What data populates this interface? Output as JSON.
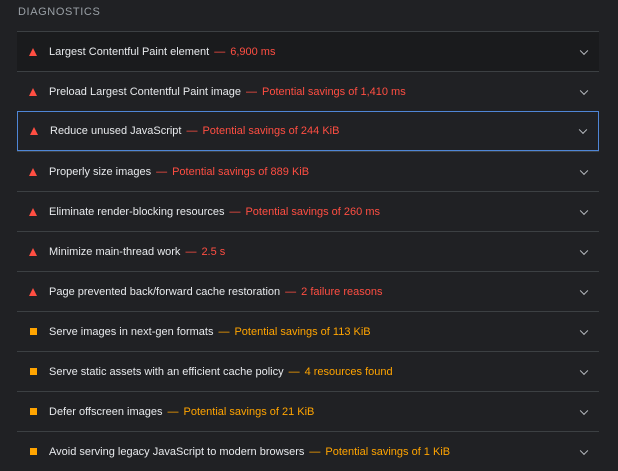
{
  "section": {
    "title": "DIAGNOSTICS"
  },
  "audits": [
    {
      "title": "Largest Contentful Paint element",
      "detail": "6,900 ms",
      "severity": "fail",
      "separator": "—"
    },
    {
      "title": "Preload Largest Contentful Paint image",
      "detail": "Potential savings of 1,410 ms",
      "severity": "fail",
      "separator": "—"
    },
    {
      "title": "Reduce unused JavaScript",
      "detail": "Potential savings of 244 KiB",
      "severity": "fail",
      "separator": "—"
    },
    {
      "title": "Properly size images",
      "detail": "Potential savings of 889 KiB",
      "severity": "fail",
      "separator": "—"
    },
    {
      "title": "Eliminate render-blocking resources",
      "detail": "Potential savings of 260 ms",
      "severity": "fail",
      "separator": "—"
    },
    {
      "title": "Minimize main-thread work",
      "detail": "2.5 s",
      "severity": "fail",
      "separator": "—"
    },
    {
      "title": "Page prevented back/forward cache restoration",
      "detail": "2 failure reasons",
      "severity": "fail",
      "separator": "—"
    },
    {
      "title": "Serve images in next-gen formats",
      "detail": "Potential savings of 113 KiB",
      "severity": "warn",
      "separator": "—"
    },
    {
      "title": "Serve static assets with an efficient cache policy",
      "detail": "4 resources found",
      "severity": "warn",
      "separator": "—"
    },
    {
      "title": "Defer offscreen images",
      "detail": "Potential savings of 21 KiB",
      "severity": "warn",
      "separator": "—"
    },
    {
      "title": "Avoid serving legacy JavaScript to modern browsers",
      "detail": "Potential savings of 1 KiB",
      "severity": "warn",
      "separator": "—"
    }
  ],
  "colors": {
    "fail": "#ff4e42",
    "warn": "#ffa400",
    "focus": "#4f86d6"
  }
}
